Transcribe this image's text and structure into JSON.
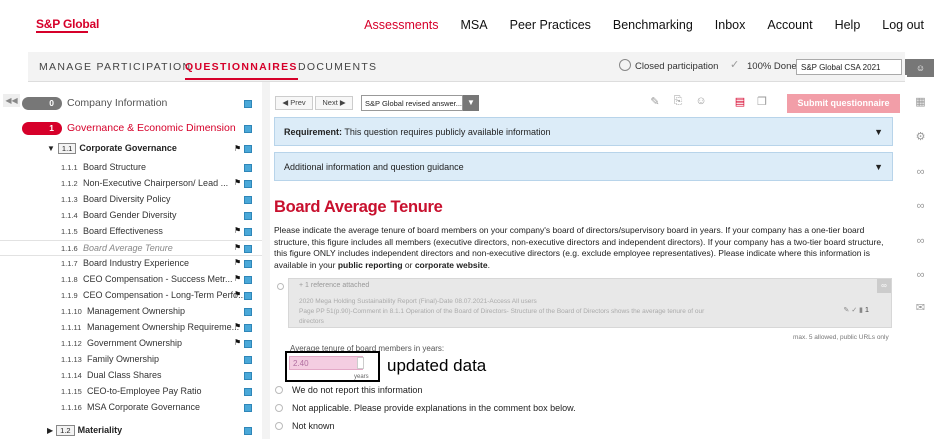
{
  "logo": "S&P Global",
  "nav": [
    "Assessments",
    "MSA",
    "Peer Practices",
    "Benchmarking",
    "Inbox",
    "Account",
    "Help",
    "Log out"
  ],
  "nav_active": "Assessments",
  "tabs": [
    "MANAGE PARTICIPATION",
    "QUESTIONNAIRES",
    "DOCUMENTS"
  ],
  "tab_active": "QUESTIONNAIRES",
  "status": {
    "participation": "Closed participation",
    "done": "100% Done",
    "questionnaire_select": "S&P Global CSA 2021",
    "select_arrow": "▼"
  },
  "sidebar": {
    "collapse": "◀◀",
    "sections": [
      {
        "num": "0",
        "label": "Company Information",
        "color": "#888888"
      },
      {
        "num": "1",
        "label": "Governance & Economic Dimension",
        "color": "#d6002a"
      }
    ],
    "subsections": [
      {
        "code": "1.1",
        "label": "Corporate Governance",
        "expanded": "▼"
      },
      {
        "code": "1.2",
        "label": "Materiality",
        "expanded": "▶"
      }
    ],
    "items": [
      {
        "num": "1.1.1",
        "label": "Board Structure"
      },
      {
        "num": "1.1.2",
        "label": "Non-Executive Chairperson/ Lead ..."
      },
      {
        "num": "1.1.3",
        "label": "Board Diversity Policy"
      },
      {
        "num": "1.1.4",
        "label": "Board Gender Diversity"
      },
      {
        "num": "1.1.5",
        "label": "Board Effectiveness"
      },
      {
        "num": "1.1.6",
        "label": "Board Average Tenure"
      },
      {
        "num": "1.1.7",
        "label": "Board Industry Experience"
      },
      {
        "num": "1.1.8",
        "label": "CEO Compensation - Success Metr..."
      },
      {
        "num": "1.1.9",
        "label": "CEO Compensation - Long-Term Perfo..."
      },
      {
        "num": "1.1.10",
        "label": "Management Ownership"
      },
      {
        "num": "1.1.11",
        "label": "Management Ownership Requireme..."
      },
      {
        "num": "1.1.12",
        "label": "Government Ownership"
      },
      {
        "num": "1.1.13",
        "label": "Family Ownership"
      },
      {
        "num": "1.1.14",
        "label": "Dual Class Shares"
      },
      {
        "num": "1.1.15",
        "label": "CEO-to-Employee Pay Ratio"
      },
      {
        "num": "1.1.16",
        "label": "MSA Corporate Governance"
      }
    ]
  },
  "toolbar": {
    "prev": "◀ Prev",
    "next": "Next ▶",
    "answer_select": "S&P Global revised answer...",
    "answer_arrow": "▼",
    "submit": "Submit questionnaire"
  },
  "requirement": {
    "label": "Requirement:",
    "text": "This question requires publicly available information",
    "caret": "▼"
  },
  "guidance": {
    "text": "Additional information and question guidance",
    "caret": "▼"
  },
  "question": {
    "title": "Board Average Tenure",
    "desc_1": "Please indicate the average tenure of board members on your company's board of directors/supervisory board in years. If your company has a one-tier board structure, this figure includes all members (executive directors, non-executive directors and independent directors). If your company has a two-tier board structure, this figure ONLY includes independent directors and non-executive directors (e.g. exclude employee representatives). Please indicate where this information is available in your",
    "desc_bold_1": "public reporting",
    "desc_or": "or",
    "desc_bold_2": "corporate website",
    "desc_end": "."
  },
  "reference": {
    "head": "+   1 reference attached",
    "line1": "2020 Mega Holding Sustainability Report (Final)-Date 08.07.2021-Access All users",
    "line2": "Page PP 51(p.90)-Comment in 8.1.1 Operation of the Board of Directors- Structure of the Board of Directors shows the average tenure of our",
    "line3": "directors",
    "count": "1",
    "max_note": "max. 5 allowed, public URLs only"
  },
  "tenure_input": {
    "label": "Average tenure of board members in years:",
    "value": "2.40",
    "unit": "years"
  },
  "annotation": "updated data",
  "options": [
    "We do not report this information",
    "Not applicable. Please provide explanations in the comment box below.",
    "Not known"
  ]
}
